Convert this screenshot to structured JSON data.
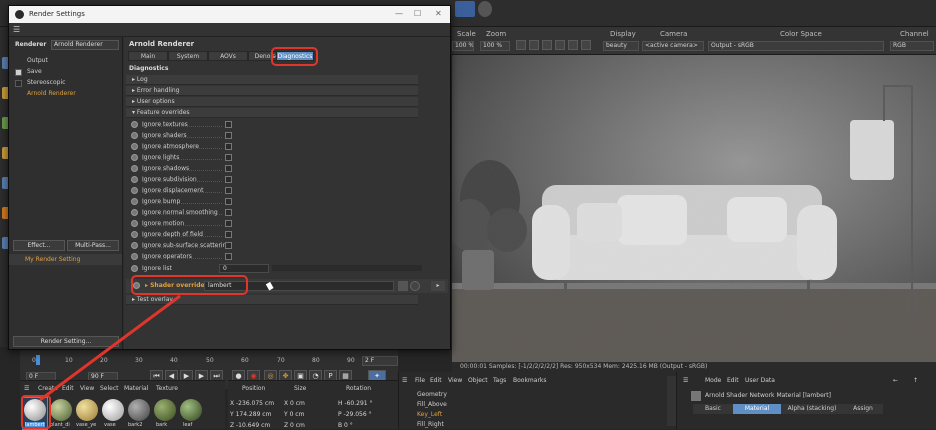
{
  "dialog": {
    "title": "Render Settings",
    "renderer_label": "Renderer",
    "renderer_value": "Arnold Renderer",
    "tree_items": [
      "Output",
      "Save",
      "Stereoscopic",
      "Arnold Renderer"
    ],
    "effect_button": "Effect...",
    "multipass_button": "Multi-Pass...",
    "setting_name": "My Render Setting",
    "render_setting_button": "Render Setting...",
    "panel_title": "Arnold Renderer",
    "tabs": [
      "Main",
      "System",
      "AOVs",
      "Denoiser",
      "Diagnostics"
    ],
    "section_title": "Diagnostics",
    "groups": [
      "Log",
      "Error handling",
      "User options",
      "Feature overrides"
    ],
    "overrides": [
      "Ignore textures",
      "Ignore shaders",
      "Ignore atmosphere",
      "Ignore lights",
      "Ignore shadows",
      "Ignore subdivision",
      "Ignore displacement",
      "Ignore bump",
      "Ignore normal smoothing",
      "Ignore motion",
      "Ignore depth of field",
      "Ignore sub-surface scattering",
      "Ignore operators"
    ],
    "ignore_list_label": "Ignore list",
    "ignore_list_value": "0",
    "shader_override_label": "Shader override*",
    "shader_override_value": "lambert",
    "test_overlay": "Test overlay"
  },
  "viewport_header": {
    "scale_label": "Scale",
    "scale_value": "100 %",
    "zoom_label": "Zoom",
    "zoom_value": "100 %",
    "display_label": "Display",
    "display_value": "beauty",
    "camera_label": "Camera",
    "camera_value": "<active camera>",
    "output_value": "Output - sRGB",
    "color_space_label": "Color Space",
    "channel_label": "Channel",
    "channel_value": "RGB"
  },
  "viewport_status": "00:00:01  Samples: [-1/2/2/2/2/2]  Res: 950x534  Mem: 2425.16 MB  (Output - sRGB)",
  "timeline": {
    "ticks": [
      "0",
      "10",
      "20",
      "30",
      "40",
      "50",
      "60",
      "70",
      "80",
      "90"
    ],
    "start_field": "0 F",
    "end_field": "90 F",
    "current_frame": "2 F"
  },
  "material_manager": {
    "menu": [
      "Create",
      "Edit",
      "View",
      "Select",
      "Material",
      "Texture"
    ],
    "materials": [
      "lambert",
      "plant_di",
      "vase_ye",
      "vase",
      "bark2",
      "bark",
      "leaf"
    ]
  },
  "coordinates": {
    "headers": [
      "Position",
      "Size",
      "Rotation"
    ],
    "x_pos": "X  -236.075 cm",
    "x_size": "X  0 cm",
    "h_rot": "H  -60.291 °",
    "y_pos": "Y  174.289 cm",
    "y_size": "Y  0 cm",
    "p_rot": "P  -29.056 °",
    "z_pos": "Z  -10.649 cm",
    "z_size": "Z  0 cm",
    "b_rot": "B  0 °"
  },
  "object_manager": {
    "menu": [
      "File",
      "Edit",
      "View",
      "Object",
      "Tags",
      "Bookmarks"
    ],
    "objects": [
      "Geometry",
      "Fill_Above",
      "Key_Left",
      "Fill_Right"
    ]
  },
  "attribute_manager": {
    "menu": [
      "Mode",
      "Edit",
      "User Data"
    ],
    "title": "Arnold Shader Network Material [lambert]",
    "tabs": [
      "Basic",
      "Material",
      "Alpha (stacking)",
      "Assign"
    ]
  },
  "colors": {
    "accent_red": "#e0352a",
    "active_tab": "#5f8fc4",
    "highlight_orange": "#e0a040"
  }
}
